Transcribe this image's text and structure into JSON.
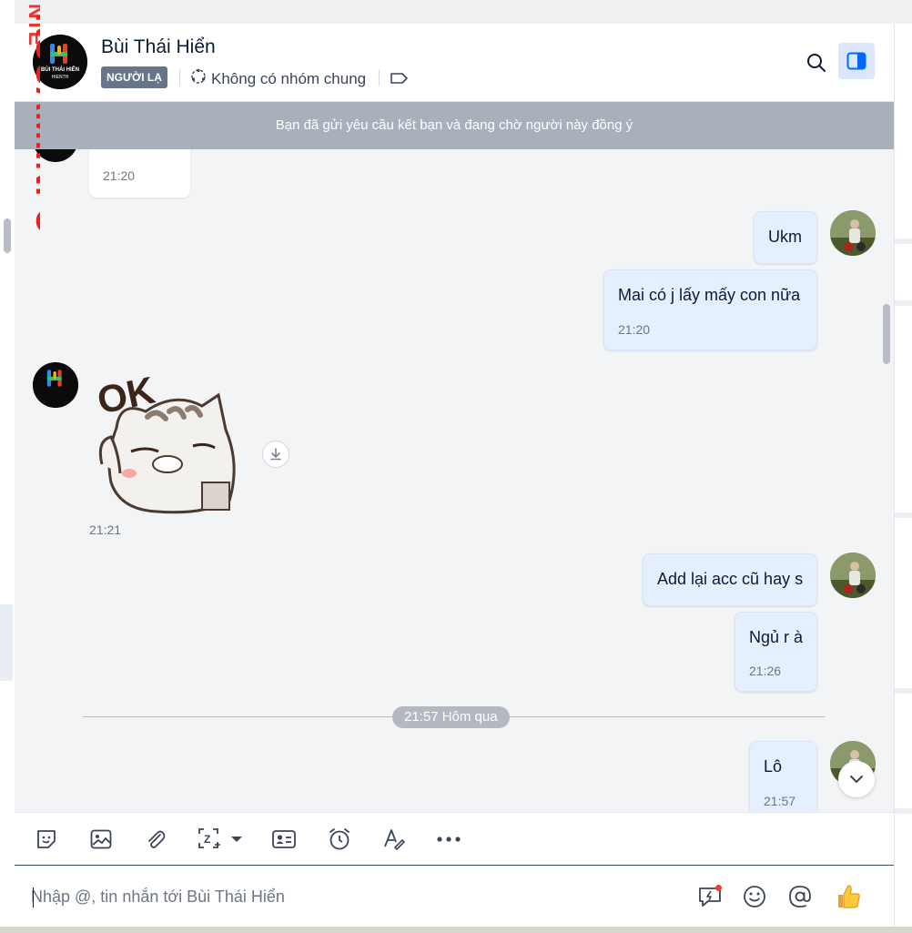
{
  "watermark": {
    "text": "KSCAM.INFO",
    "fragment": "NTE"
  },
  "header": {
    "contact_name": "Bùi Thái Hiển",
    "badge": "NGƯỜI LẠ",
    "common_groups": "Không có nhóm chung",
    "avatar_logo_text": "BÙI THÁI HIỂN",
    "avatar_logo_sub": "HIENTH",
    "icons": [
      "search-icon",
      "sidebar-toggle-icon",
      "tag-icon",
      "group-icon"
    ]
  },
  "friend_request_banner": "Bạn đã gửi yêu cầu kết bạn và đang chờ người này đồng ý",
  "messages": [
    {
      "from": "them",
      "type": "text",
      "text": "",
      "time": "21:20"
    },
    {
      "from": "me",
      "type": "text",
      "text": "Ukm",
      "time": ""
    },
    {
      "from": "me",
      "type": "text",
      "text": "Mai có j lấy mấy con nữa",
      "time": "21:20"
    },
    {
      "from": "them",
      "type": "sticker",
      "sticker_text": "OK",
      "time": "21:21"
    },
    {
      "from": "me",
      "type": "text",
      "text": "Add lại acc cũ hay s",
      "time": ""
    },
    {
      "from": "me",
      "type": "text",
      "text": "Ngủ r à",
      "time": "21:26"
    },
    {
      "from": "me",
      "type": "text",
      "text": "Lô",
      "time": "21:57"
    }
  ],
  "divider": "21:57 Hôm qua",
  "toolbar": {
    "items": [
      "sticker-icon",
      "image-icon",
      "attachment-icon",
      "screenshot-icon",
      "contact-card-icon",
      "reminder-icon",
      "text-format-icon",
      "more-icon"
    ]
  },
  "composer": {
    "placeholder": "Nhập @, tin nhắn tới Bùi Thái Hiển",
    "icons": [
      "quick-message-icon",
      "emoji-icon",
      "mention-icon",
      "thumbs-up-icon"
    ]
  },
  "colors": {
    "accent": "#0068ff",
    "out_bubble": "#e5efff",
    "in_bubble": "#ffffff",
    "banner": "#a8b0bb",
    "badge": "#67748a",
    "watermark": "#e8221b"
  }
}
